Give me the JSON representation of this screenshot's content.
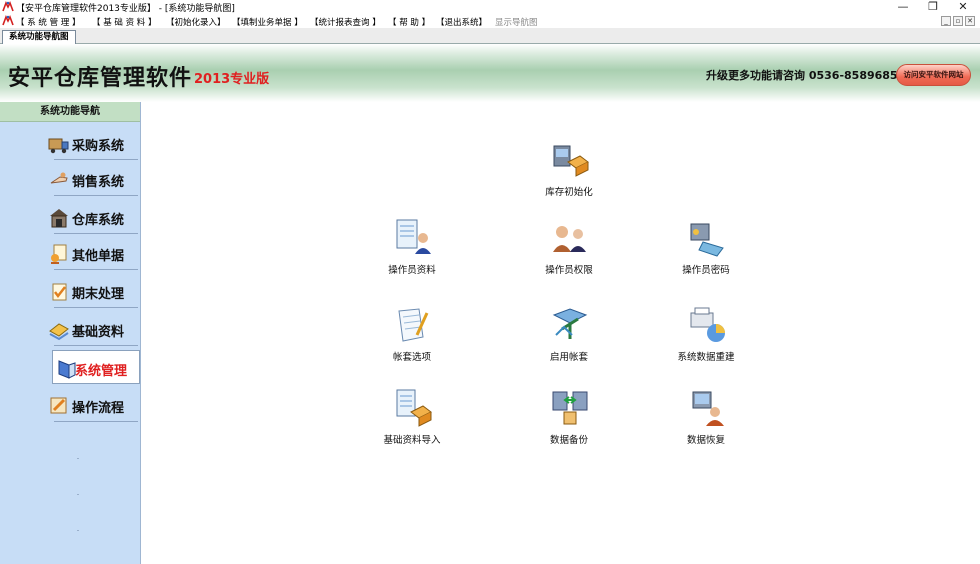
{
  "window": {
    "title": "【安平仓库管理软件2013专业版】 - [系统功能导航图]",
    "controls": {
      "minimize": "—",
      "restore": "❐",
      "close": "✕"
    }
  },
  "menubar": {
    "items": [
      "【 系 统 管 理 】",
      "【 基 础 资 料 】",
      "【初始化录入】",
      "【填制业务单据 】",
      "【统计报表查询 】",
      "【 帮 助 】",
      "【退出系统】",
      "显示导航图"
    ],
    "mdi_controls": [
      "_",
      "▫",
      "✕"
    ]
  },
  "tabs": {
    "active": "系统功能导航图"
  },
  "banner": {
    "app_name": "安平仓库管理软件",
    "edition": "2013专业版",
    "contact": "升级更多功能请咨询  0536-8589685",
    "visit_button": "访问安平软件网站"
  },
  "sidebar": {
    "header": "系统功能导航",
    "items": [
      {
        "label": "采购系统",
        "icon": "truck-icon"
      },
      {
        "label": "销售系统",
        "icon": "sales-icon"
      },
      {
        "label": "仓库系统",
        "icon": "warehouse-icon"
      },
      {
        "label": "其他单据",
        "icon": "documents-icon"
      },
      {
        "label": "期末处理",
        "icon": "period-end-icon"
      },
      {
        "label": "基础资料",
        "icon": "basic-data-icon"
      },
      {
        "label": "系统管理",
        "icon": "system-icon"
      },
      {
        "label": "操作流程",
        "icon": "workflow-icon"
      }
    ],
    "active": "系统管理"
  },
  "functions": [
    {
      "label": "库存初始化",
      "icon": "inventory-init-icon"
    },
    {
      "label": "操作员资料",
      "icon": "operator-info-icon"
    },
    {
      "label": "操作员权限",
      "icon": "operator-permission-icon"
    },
    {
      "label": "操作员密码",
      "icon": "operator-password-icon"
    },
    {
      "label": "帐套选项",
      "icon": "account-options-icon"
    },
    {
      "label": "启用帐套",
      "icon": "enable-account-icon"
    },
    {
      "label": "系统数据重建",
      "icon": "data-rebuild-icon"
    },
    {
      "label": "基础资料导入",
      "icon": "data-import-icon"
    },
    {
      "label": "数据备份",
      "icon": "data-backup-icon"
    },
    {
      "label": "数据恢复",
      "icon": "data-restore-icon"
    }
  ],
  "colors": {
    "accent_red": "#e02020",
    "sidebar_bg": "#c7ddf6",
    "banner_green": "#a9cfb0"
  }
}
